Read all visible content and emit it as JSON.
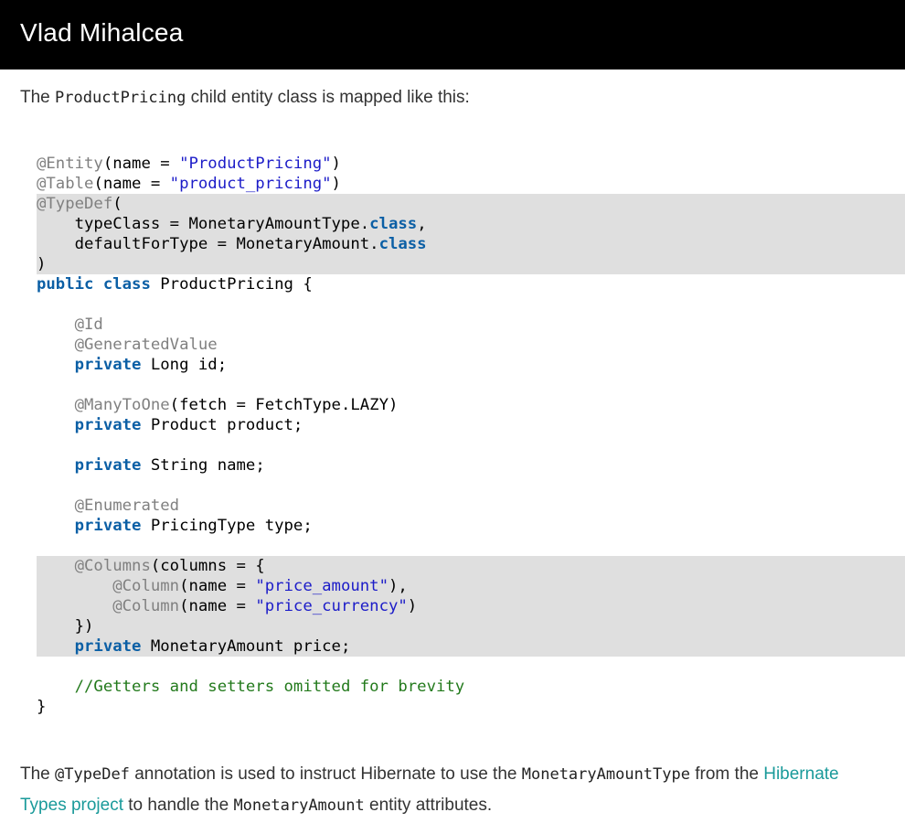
{
  "header": {
    "site_title": "Vlad Mihalcea"
  },
  "intro": {
    "before": "The ",
    "class_code": "ProductPricing",
    "after": " child entity class is mapped like this:"
  },
  "code": {
    "l1": {
      "a": "@Entity",
      "b": "(name = ",
      "s": "\"ProductPricing\"",
      "c": ")"
    },
    "l2": {
      "a": "@Table",
      "b": "(name = ",
      "s": "\"product_pricing\"",
      "c": ")"
    },
    "l3": {
      "a": "@TypeDef",
      "b": "("
    },
    "l4": {
      "b": "    typeClass = MonetaryAmountType.",
      "k": "class",
      "c": ","
    },
    "l5": {
      "b": "    defaultForType = MonetaryAmount.",
      "k": "class"
    },
    "l6": {
      "b": ")"
    },
    "l7": {
      "k1": "public",
      "sp": " ",
      "k2": "class",
      "b": " ProductPricing {"
    },
    "l9": {
      "i": "    ",
      "a": "@Id"
    },
    "l10": {
      "i": "    ",
      "a": "@GeneratedValue"
    },
    "l11": {
      "i": "    ",
      "k": "private",
      "b": " Long id;"
    },
    "l13": {
      "i": "    ",
      "a": "@ManyToOne",
      "b": "(fetch = FetchType.LAZY)"
    },
    "l14": {
      "i": "    ",
      "k": "private",
      "b": " Product product;"
    },
    "l16": {
      "i": "    ",
      "k": "private",
      "b": " String name;"
    },
    "l18": {
      "i": "    ",
      "a": "@Enumerated"
    },
    "l19": {
      "i": "    ",
      "k": "private",
      "b": " PricingType type;"
    },
    "l21": {
      "i": "    ",
      "a": "@Columns",
      "b": "(columns = {"
    },
    "l22": {
      "i": "        ",
      "a": "@Column",
      "b": "(name = ",
      "s": "\"price_amount\"",
      "c": "),"
    },
    "l23": {
      "i": "        ",
      "a": "@Column",
      "b": "(name = ",
      "s": "\"price_currency\"",
      "c": ")"
    },
    "l24": {
      "b": "    })"
    },
    "l25": {
      "i": "    ",
      "k": "private",
      "b": " MonetaryAmount price;"
    },
    "l27": {
      "i": "    ",
      "cm": "//Getters and setters omitted for brevity"
    },
    "l28": {
      "b": "}"
    }
  },
  "outro": {
    "p1": "The ",
    "c1": "@TypeDef",
    "p2": " annotation is used to instruct Hibernate to use the ",
    "c2": "MonetaryAmountType",
    "p3": " from the ",
    "link1": "Hibernate",
    "link2": "Types project",
    "p4": " to handle the ",
    "c3": "MonetaryAmount",
    "p5": " entity attributes."
  }
}
